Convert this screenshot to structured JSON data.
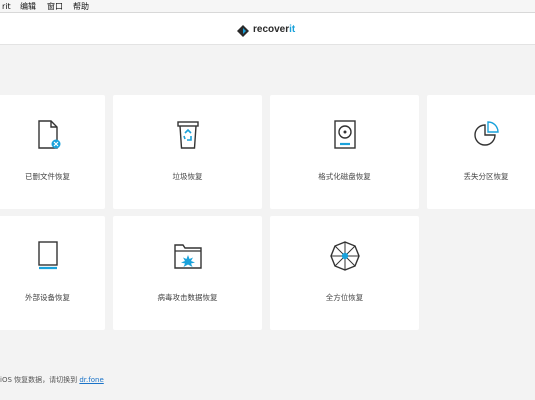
{
  "menubar": {
    "items": [
      "rit",
      "编辑",
      "窗口",
      "帮助"
    ]
  },
  "app": {
    "logo_text_main": "recover",
    "logo_text_accent": "it"
  },
  "cards": [
    {
      "label": "已删文件恢复",
      "icon": "deleted-file-icon"
    },
    {
      "label": "垃圾恢复",
      "icon": "recycle-bin-icon"
    },
    {
      "label": "格式化磁盘恢复",
      "icon": "formatted-disk-icon"
    },
    {
      "label": "丢失分区恢复",
      "icon": "lost-partition-icon"
    },
    {
      "label": "外部设备恢复",
      "icon": "external-device-icon"
    },
    {
      "label": "病毒攻击数据恢复",
      "icon": "virus-attack-icon"
    },
    {
      "label": "全方位恢复",
      "icon": "all-round-recovery-icon"
    }
  ],
  "footer": {
    "text": "iOS 恢复数据，请切换到",
    "link": "dr.fone"
  },
  "colors": {
    "accent": "#1aa2db",
    "background": "#f3f3f3",
    "card": "#ffffff"
  }
}
